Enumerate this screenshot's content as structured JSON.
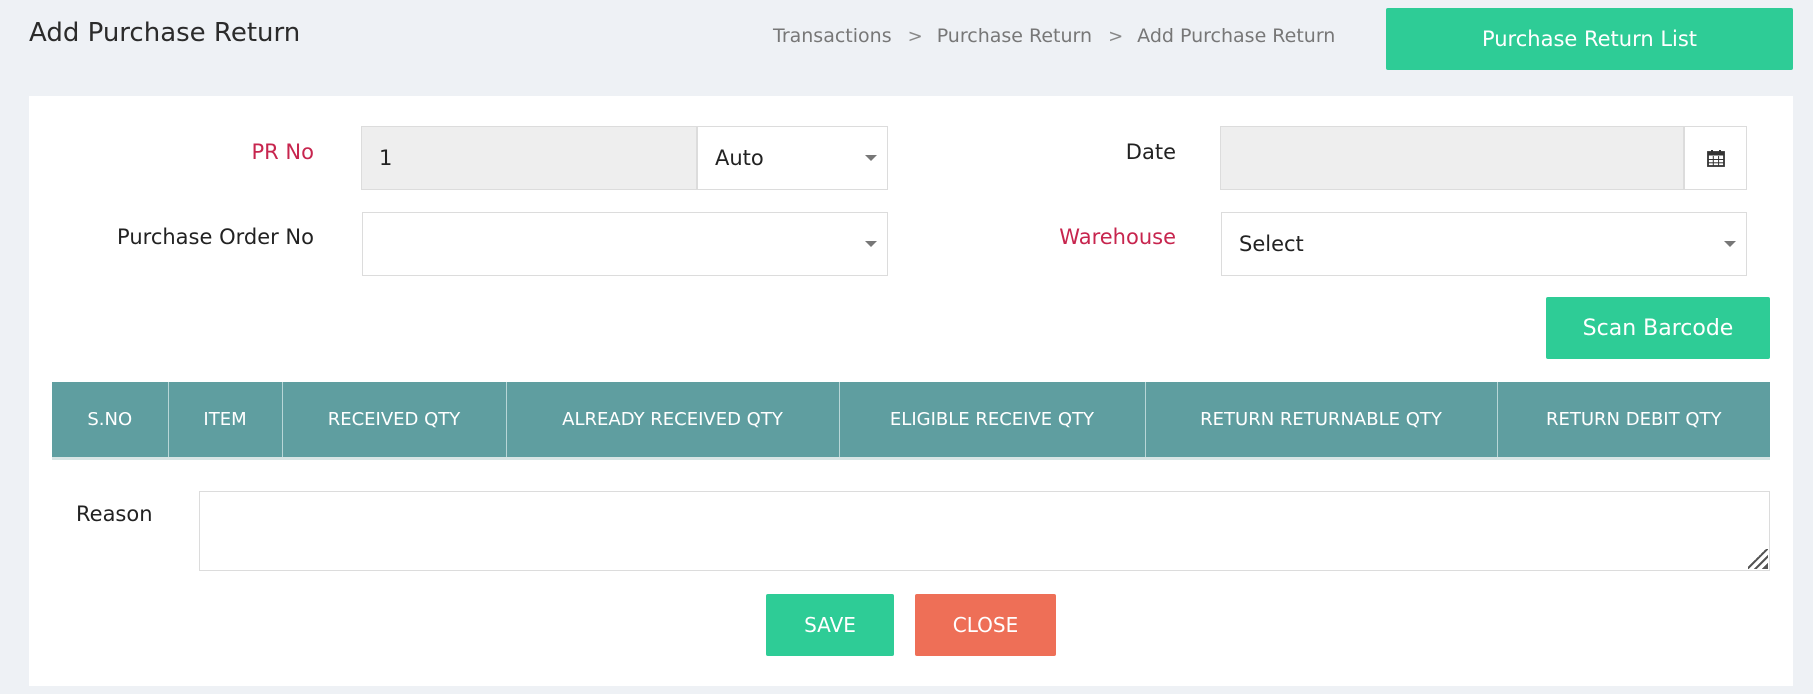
{
  "header": {
    "title": "Add Purchase Return",
    "breadcrumb": [
      "Transactions",
      "Purchase Return",
      "Add Purchase Return"
    ],
    "separator": ">",
    "list_button": "Purchase Return List"
  },
  "form": {
    "pr_no_label": "PR No",
    "pr_no_value": "1",
    "pr_mode_value": "Auto",
    "date_label": "Date",
    "date_value": "",
    "purchase_order_label": "Purchase Order No",
    "purchase_order_value": "",
    "warehouse_label": "Warehouse",
    "warehouse_value": "Select"
  },
  "scan_button": "Scan Barcode",
  "table": {
    "columns": [
      "S.NO",
      "ITEM",
      "RECEIVED QTY",
      "ALREADY RECEIVED QTY",
      "ELIGIBLE RECEIVE QTY",
      "RETURN RETURNABLE QTY",
      "RETURN DEBIT QTY"
    ],
    "rows": []
  },
  "reason": {
    "label": "Reason",
    "value": ""
  },
  "actions": {
    "save": "SAVE",
    "close": "CLOSE"
  },
  "colors": {
    "accent_green": "#2ecc96",
    "close_red": "#ee6f57",
    "table_header": "#5f9ea0",
    "required_label": "#c7254e"
  }
}
